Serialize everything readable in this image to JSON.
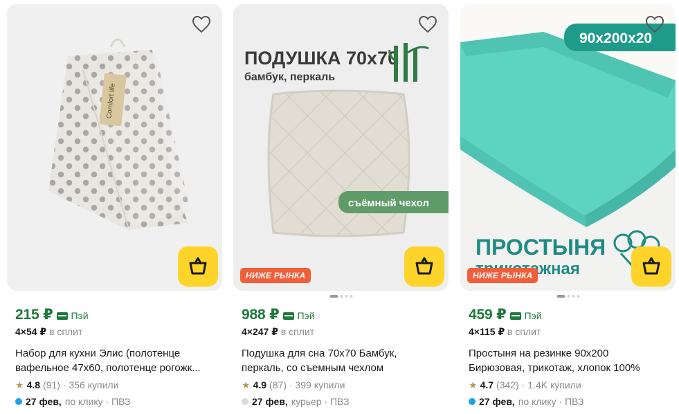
{
  "colors": {
    "price_green": "#1f7a3b",
    "cart_yellow": "#fed42b",
    "badge_red": "#f25e3a",
    "click_dot": "#1fa0e8",
    "courier_dot": "#d9d9d9",
    "star": "#b59a5b"
  },
  "products": [
    {
      "image": {
        "alt": "towels",
        "brand_tag": "Comfort life"
      },
      "badge": "",
      "price": "215 ₽",
      "pay_label": "Пэй",
      "split_amount": "4×54 ₽",
      "split_label": "в сплит",
      "title_lines": [
        "Набор для кухни Элис (полотенце",
        "вафельное 47х60, полотенце рогожк..."
      ],
      "rating": "4.8",
      "reviews": "(91)",
      "sold": "· 356 купили",
      "delivery_date": "27 фев,",
      "delivery_method": "по клику · ПВЗ",
      "delivery_dot": "click"
    },
    {
      "image": {
        "alt": "pillow",
        "headline": "ПОДУШКА 70х70",
        "subline": "бамбук, перкаль",
        "ribbon": "съёмный чехол"
      },
      "badge": "НИЖЕ РЫНКА",
      "price": "988 ₽",
      "pay_label": "Пэй",
      "split_amount": "4×247 ₽",
      "split_label": "в сплит",
      "title_lines": [
        "Подушка для сна 70х70 Бамбук,",
        "перкаль, со съемным чехлом"
      ],
      "rating": "4.9",
      "reviews": "(87)",
      "sold": "· 399 купили",
      "delivery_date": "27 фев,",
      "delivery_method": "курьер · ПВЗ",
      "delivery_dot": "courier"
    },
    {
      "image": {
        "alt": "sheet",
        "size_tag": "90x200x20",
        "headline": "ПРОСТЫНЯ",
        "subline": "трикотажная"
      },
      "badge": "НИЖЕ РЫНКА",
      "price": "459 ₽",
      "pay_label": "Пэй",
      "split_amount": "4×115 ₽",
      "split_label": "в сплит",
      "title_lines": [
        "Простыня на резинке 90х200",
        "Бирюзовая, трикотаж, хлопок 100%"
      ],
      "rating": "4.7",
      "reviews": "(342)",
      "sold": "· 1.4K купили",
      "delivery_date": "27 фев,",
      "delivery_method": "по клику · ПВЗ",
      "delivery_dot": "click"
    }
  ]
}
